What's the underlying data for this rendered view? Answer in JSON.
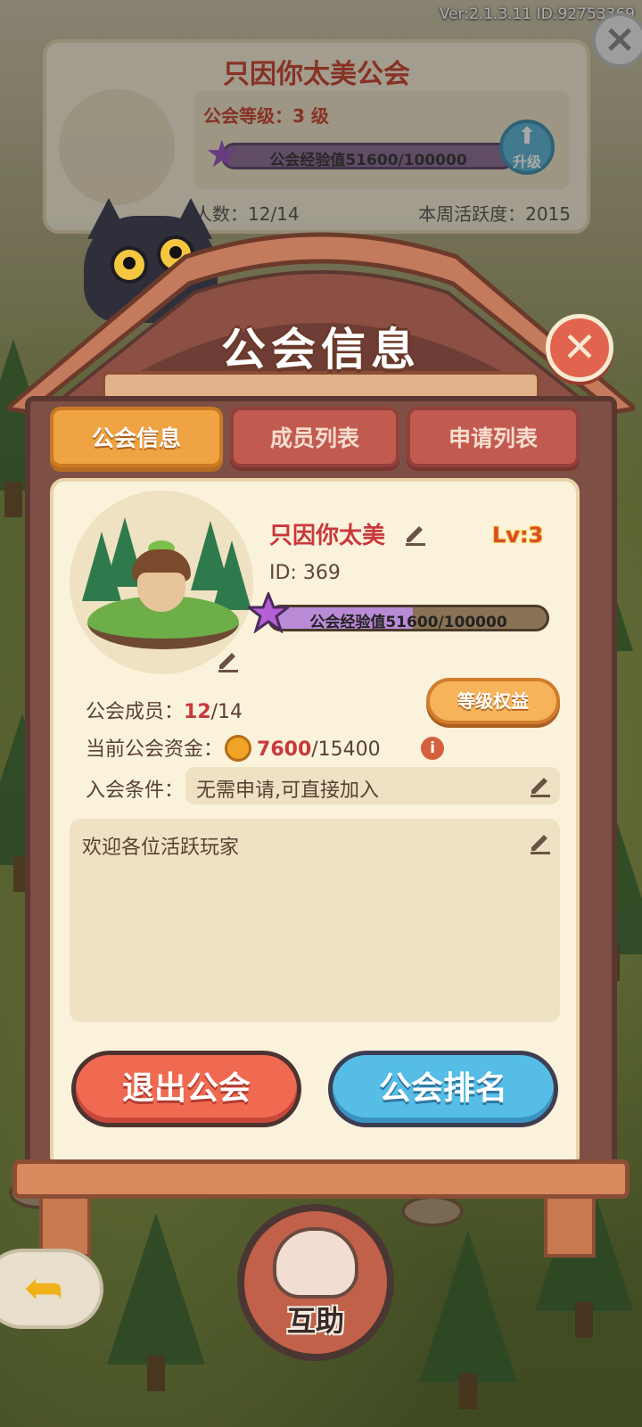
{
  "status": {
    "version": "Ver:2.1.3.11 ID:92753369"
  },
  "background_card": {
    "guild_name": "只因你太美公会",
    "level_text": "公会等级：3 级",
    "xp_text": "公会经验值51600/100000",
    "upgrade_label": "升级",
    "members_text": "人数：12/14",
    "weekly_activity_text": "本周活跃度：2015"
  },
  "modal": {
    "title": "公会信息",
    "tabs": [
      {
        "label": "公会信息",
        "active": true
      },
      {
        "label": "成员列表",
        "active": false
      },
      {
        "label": "申请列表",
        "active": false
      }
    ],
    "guild": {
      "name": "只因你太美",
      "level_badge": "Lv:3",
      "id_text": "ID: 369",
      "xp_label": "公会经验值51600/100000",
      "xp_fraction": 0.516
    },
    "members_label": "公会成员：",
    "members_value": "12",
    "members_max": "/14",
    "benefit_button": "等级权益",
    "funds_label": "当前公会资金：",
    "funds_value": "7600",
    "funds_max": "/15400",
    "join_label": "入会条件：",
    "join_value": "无需申请,可直接加入",
    "description": "欢迎各位活跃玩家",
    "exit_button": "退出公会",
    "rank_button": "公会排名"
  },
  "help_button": {
    "label": "互助"
  },
  "colors": {
    "accent_orange": "#f0a343",
    "exit_red": "#f06a51",
    "rank_blue": "#55bde6",
    "frame_brown": "#7e4f45"
  },
  "icons": [
    "close-icon",
    "pencil-icon",
    "star-icon",
    "coin-icon",
    "info-icon",
    "upgrade-arrow-icon",
    "paw-icon",
    "back-arrow-icon"
  ]
}
